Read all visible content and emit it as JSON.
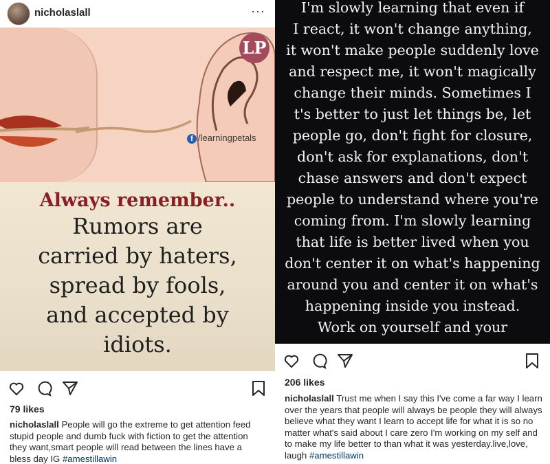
{
  "left_post": {
    "username": "nicholaslall",
    "more": "···",
    "image": {
      "badge": "LP",
      "handle": "/learningpetals",
      "fb_letter": "f",
      "quote_head": "Always remember..",
      "quote_lines": [
        "Rumors are",
        "carried by haters,",
        "spread by fools,",
        "and accepted by",
        "idiots."
      ]
    },
    "likes": "79 likes",
    "caption_user": "nicholaslall",
    "caption_text": " People will go the extreme to get attention feed stupid people and dumb fuck with fiction to get the attention they want,smart people will read between the lines have a bless day IG ",
    "hashtag": "#amestillawin"
  },
  "right_post": {
    "image_lines": [
      "I'm slowly learning that even if",
      "I react, it won't change anything,",
      "it won't make people suddenly love",
      "and respect me, it won't magically",
      "change their minds. Sometimes I",
      "t's better to just let things be, let",
      "people go, don't fight for closure,",
      "don't ask for explanations, don't",
      "chase answers and don't expect",
      "people to understand where you're",
      "coming from. I'm slowly learning",
      "that life is better lived when you",
      "don't center it on what's happening",
      "around you and center it on what's",
      "happening inside you instead.",
      "Work on yourself and your"
    ],
    "likes": "206 likes",
    "caption_user": "nicholaslall",
    "caption_text": " Trust me when I say this I've come a far way I learn over the years that people will always be people they will always believe what they want I learn to accept life for what it is so no matter what's said about I care zero I'm working on my self and to make my life better to than what it was yesterday.live,love, laugh ",
    "hashtag": "#amestillawin"
  },
  "colors": {
    "quote_red": "#8b1d24",
    "badge": "#a34a5c",
    "hashtag": "#003569",
    "dark_bg": "#0c0c0e"
  },
  "icons": [
    "heart-icon",
    "comment-icon",
    "share-icon",
    "bookmark-icon",
    "more-icon"
  ]
}
